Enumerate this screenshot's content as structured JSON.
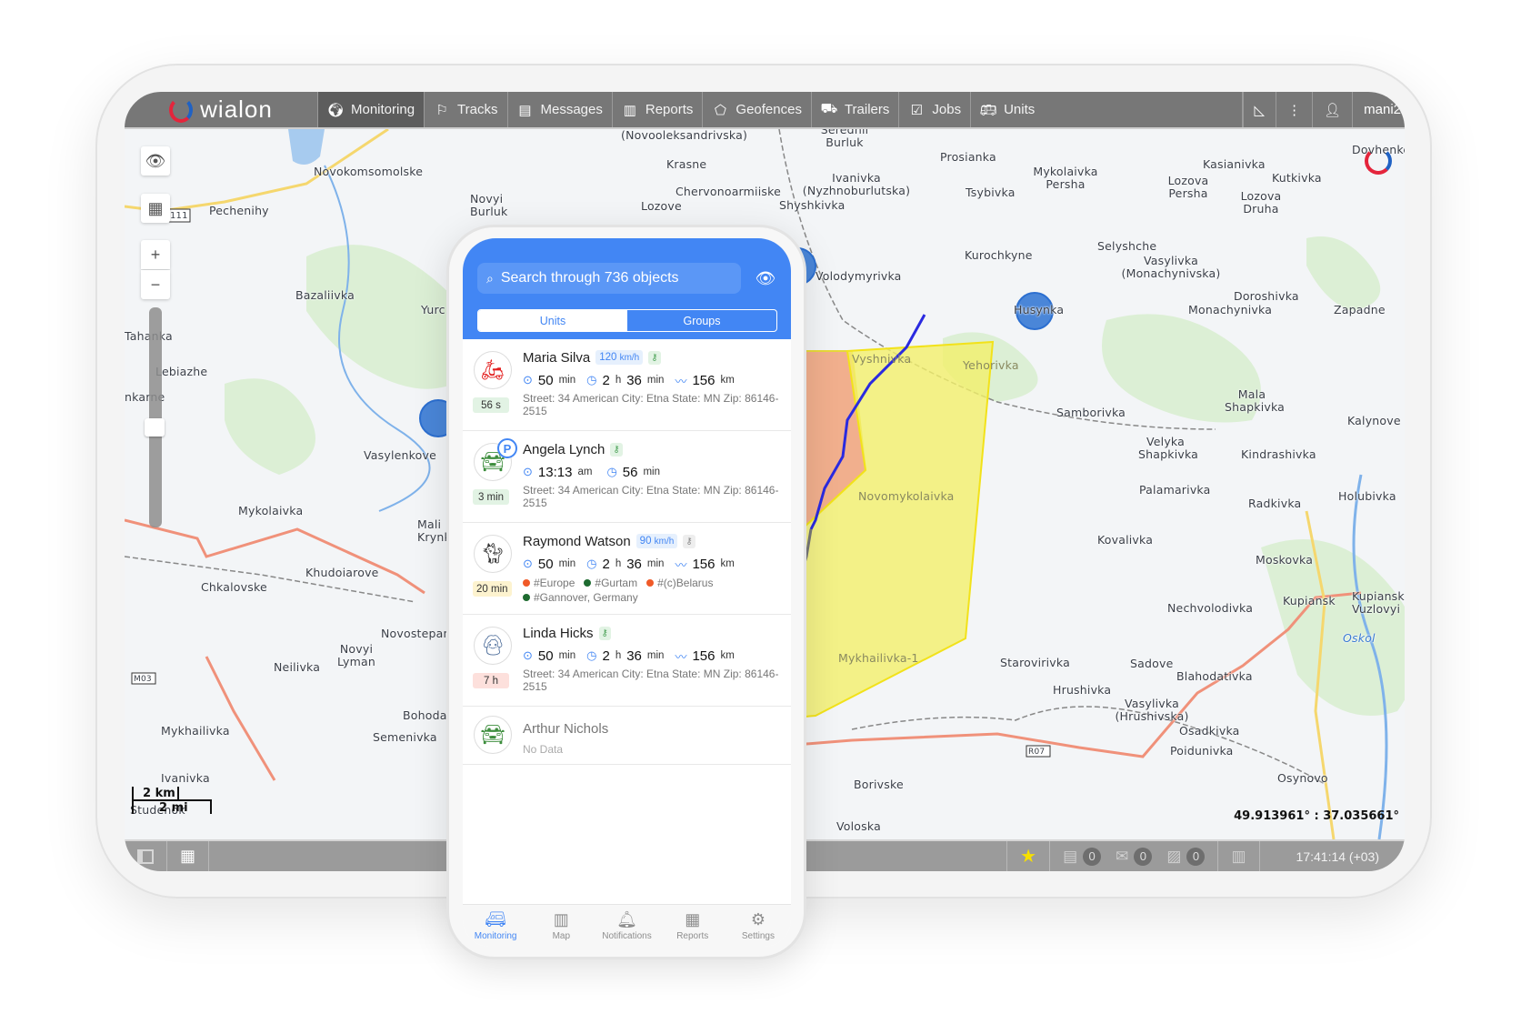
{
  "app": {
    "brand": "wialon",
    "user": "mani2"
  },
  "nav": [
    {
      "id": "monitoring",
      "label": "Monitoring",
      "icon": "globe-icon",
      "active": true
    },
    {
      "id": "tracks",
      "label": "Tracks",
      "icon": "flag-icon"
    },
    {
      "id": "messages",
      "label": "Messages",
      "icon": "document-icon"
    },
    {
      "id": "reports",
      "label": "Reports",
      "icon": "clipboard-chart-icon"
    },
    {
      "id": "geofences",
      "label": "Geofences",
      "icon": "polygon-icon"
    },
    {
      "id": "trailers",
      "label": "Trailers",
      "icon": "trailer-icon"
    },
    {
      "id": "jobs",
      "label": "Jobs",
      "icon": "checklist-icon"
    },
    {
      "id": "units",
      "label": "Units",
      "icon": "bus-icon"
    }
  ],
  "map": {
    "scale_km": "2 km",
    "scale_mi": "2 mi",
    "coordinates": "49.913961° : 37.035661°",
    "labels": [
      "(Novooleksandrivska)",
      "Serednii Burluk",
      "Prosianka",
      "Kasianivka",
      "Kutkivka",
      "Dovhenke",
      "Novokomsomolske",
      "Krasne",
      "Ivanivka (Nyzhnoburlutska)",
      "Mykolaivka Persha",
      "Lozova Persha",
      "Pechenihy",
      "Novyi Burluk",
      "Chervonoarmiiske",
      "Shyshkivka",
      "Lozove",
      "Tsybivka",
      "Lozova Druha",
      "Volodymyrivka",
      "Kurochkyne",
      "Selyshche",
      "Vasylivka (Monachynivska)",
      "Bazaliivka",
      "Yurc",
      "Husynka",
      "Doroshivka",
      "Monachynivka",
      "Zapadne",
      "Tahanka",
      "Lebiazhe",
      "nkarne",
      "Vyshnivka",
      "Yehorivka",
      "Samborivka",
      "Mala Shapkivka",
      "Kalynove",
      "Vasylenkove",
      "Velyka Shapkivka",
      "Kindrashivka",
      "Mykolaivka",
      "Mali Krynky",
      "Novomykolaivka",
      "Palamarivka",
      "Radkivka",
      "Holubivka",
      "Kovalivka",
      "Khudoiarove",
      "Moskovka",
      "Chkalovske",
      "Kupiansk",
      "Kupiansk Vuzlovyi",
      "Novostepan",
      "Nechvolodivka",
      "Oskol",
      "Novyi Lyman",
      "Neilivka",
      "Mykhailivka-1",
      "Starovirivka",
      "Sadove",
      "Blahodativka",
      "Hrushivka",
      "Vasylivka (Hrushivska)",
      "Osadkivka",
      "Mykhailivka",
      "Bohoda",
      "Semenivka",
      "Poidunivka",
      "Ivanivka",
      "Borivske",
      "Osynovo",
      "Studenok",
      "Voloska"
    ],
    "road_labels": [
      "111",
      "M03",
      "R07"
    ]
  },
  "bottombar": {
    "counters": [
      {
        "icon": "messages-icon",
        "count": "0"
      },
      {
        "icon": "mail-forward-icon",
        "count": "0"
      },
      {
        "icon": "image-icon",
        "count": "0"
      }
    ],
    "time": "17:41:14 (+03)"
  },
  "phone": {
    "search_placeholder": "Search through 736 objects",
    "segments": {
      "units": "Units",
      "groups": "Groups"
    },
    "units": [
      {
        "name": "Maria Silva",
        "avatar": "scooter-icon",
        "speed": "120",
        "speed_unit": "km/h",
        "key": "on",
        "age": "56 s",
        "age_color": "#e2f3e4",
        "s1": "50",
        "s1u": "min",
        "s2h": "2",
        "s2m": "36",
        "s3": "156",
        "s3u": "km",
        "address": "Street: 34 American City: Etna State: MN Zip: 86146-2515"
      },
      {
        "name": "Angela Lynch",
        "avatar": "car-icon",
        "parked": "P",
        "key": "on",
        "age": "3 min",
        "age_color": "#e2f3e4",
        "s1": "13:13",
        "s1u": "am",
        "s2": "56",
        "s2u": "min",
        "address": "Street: 34 American City: Etna State: MN Zip: 86146-2515"
      },
      {
        "name": "Raymond Watson",
        "avatar": "cat-icon",
        "speed": "90",
        "speed_unit": "km/h",
        "key": "off",
        "age": "20 min",
        "age_color": "#fdf3cf",
        "s1": "50",
        "s1u": "min",
        "s2h": "2",
        "s2m": "36",
        "s3": "156",
        "s3u": "km",
        "tags": [
          {
            "label": "#Europe",
            "color": "#f05a28"
          },
          {
            "label": "#Gurtam",
            "color": "#1e6b30"
          },
          {
            "label": "#(c)Belarus",
            "color": "#f05a28"
          },
          {
            "label": "#Gannover, Germany",
            "color": "#1e6b30"
          }
        ]
      },
      {
        "name": "Linda Hicks",
        "avatar": "person-icon",
        "key": "on",
        "age": "7 h",
        "age_color": "#fde0dc",
        "s1": "50",
        "s1u": "min",
        "s2h": "2",
        "s2m": "36",
        "s3": "156",
        "s3u": "km",
        "address": "Street: 34 American City: Etna State: MN Zip: 86146-2515"
      },
      {
        "name": "Arthur Nichols",
        "avatar": "car-icon",
        "status": "No Data"
      }
    ],
    "tabs": [
      {
        "label": "Monitoring",
        "icon": "van-icon",
        "active": true
      },
      {
        "label": "Map",
        "icon": "map-icon"
      },
      {
        "label": "Notifications",
        "icon": "bell-icon"
      },
      {
        "label": "Reports",
        "icon": "table-icon"
      },
      {
        "label": "Settings",
        "icon": "gear-icon"
      }
    ],
    "units_unit_h": "h",
    "units_unit_min": "min"
  }
}
